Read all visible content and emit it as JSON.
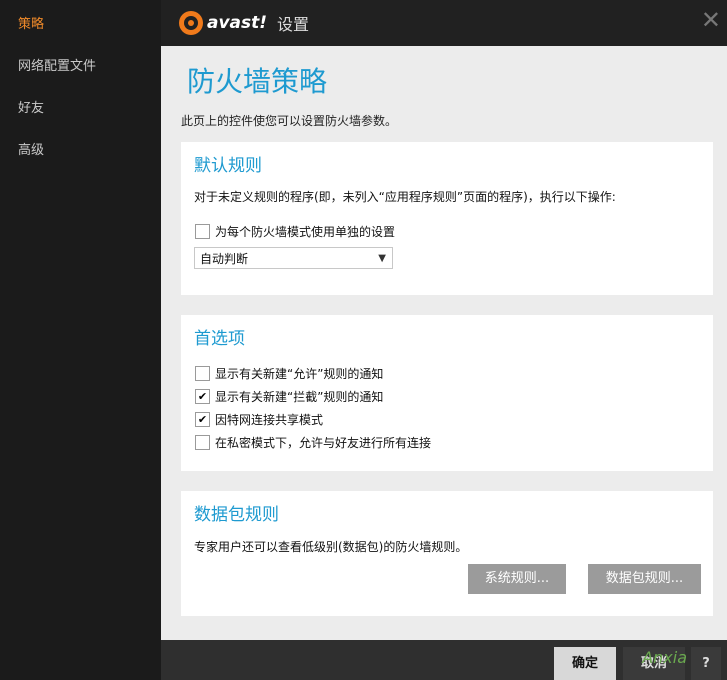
{
  "sidebar": {
    "items": [
      {
        "label": "策略",
        "active": true
      },
      {
        "label": "网络配置文件",
        "active": false
      },
      {
        "label": "好友",
        "active": false
      },
      {
        "label": "高级",
        "active": false
      }
    ]
  },
  "titlebar": {
    "logo_text": "avast!",
    "title": "设置",
    "close_glyph": "✕"
  },
  "page": {
    "title": "防火墙策略",
    "description": "此页上的控件使您可以设置防火墙参数。"
  },
  "default_rules": {
    "title": "默认规则",
    "description": "对于未定义规则的程序(即，未列入“应用程序规则”页面的程序)，执行以下操作:",
    "separate_setting_label": "为每个防火墙模式使用单独的设置",
    "separate_setting_checked": false,
    "action_select_value": "自动判断"
  },
  "preferences": {
    "title": "首选项",
    "options": [
      {
        "label": "显示有关新建“允许”规则的通知",
        "checked": false
      },
      {
        "label": "显示有关新建“拦截”规则的通知",
        "checked": true
      },
      {
        "label": "因特网连接共享模式",
        "checked": true
      },
      {
        "label": "在私密模式下，允许与好友进行所有连接",
        "checked": false
      }
    ]
  },
  "packet_rules": {
    "title": "数据包规则",
    "description": "专家用户还可以查看低级别(数据包)的防火墙规则。",
    "system_rules_button": "系统规则...",
    "packet_rules_button": "数据包规则..."
  },
  "footer": {
    "ok_button": "确定",
    "cancel_button": "取消",
    "help_button": "?",
    "watermark": "Anxia"
  },
  "colors": {
    "accent": "#1e9ad0",
    "brand_orange": "#f07a1b",
    "active_nav": "#f08a2a"
  }
}
